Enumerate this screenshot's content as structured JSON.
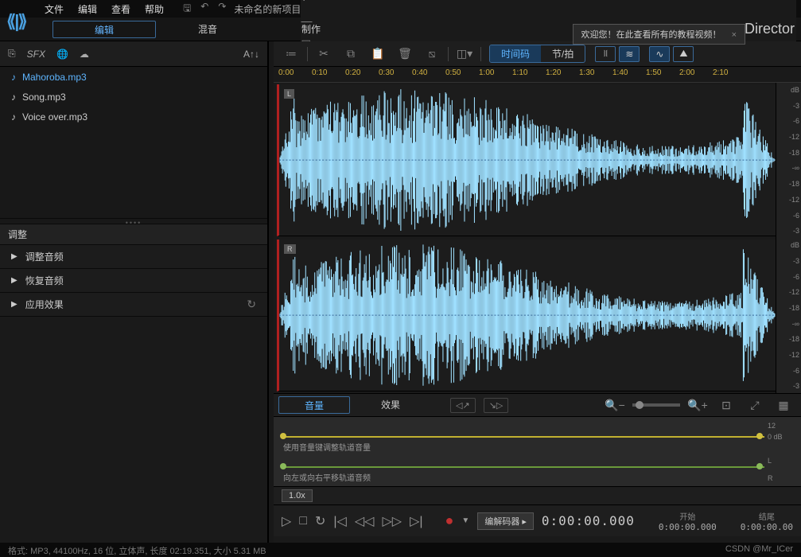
{
  "menu": {
    "file": "文件",
    "edit": "编辑",
    "view": "查看",
    "help": "帮助"
  },
  "project_title": "未命名的新项目",
  "brand": "Director",
  "modes": {
    "edit": "编辑",
    "mix": "混音",
    "produce": "制作"
  },
  "tip": {
    "text": "欢迎您！在此查看所有的教程视频！",
    "close": "×"
  },
  "filebar": {
    "sfx": "SFX",
    "font": "A↑↓"
  },
  "files": [
    {
      "name": "Mahoroba.mp3",
      "selected": true
    },
    {
      "name": "Song.mp3",
      "selected": false
    },
    {
      "name": "Voice over.mp3",
      "selected": false
    }
  ],
  "adjust": {
    "header": "调整",
    "cats": [
      "调整音频",
      "恢复音频",
      "应用效果"
    ]
  },
  "toolbar": {
    "timecode": "时间码",
    "beat": "节/拍"
  },
  "ruler": [
    "0:00",
    "0:10",
    "0:20",
    "0:30",
    "0:40",
    "0:50",
    "1:00",
    "1:10",
    "1:20",
    "1:30",
    "1:40",
    "1:50",
    "2:00",
    "2:10"
  ],
  "channels": {
    "left": "L",
    "right": "R",
    "dbhdr": "dB",
    "levels": [
      "-3",
      "-6",
      "-12",
      "-18",
      "-∞",
      "-18",
      "-12",
      "-6",
      "-3"
    ]
  },
  "fx": {
    "volume": "音量",
    "effect": "效果"
  },
  "env": {
    "vol_label": "使用音量键调整轨道音量",
    "pan_label": "向左或向右平移轨道音频",
    "scale_top": "12",
    "scale_mid": "0",
    "scale_db": "dB",
    "scale_L": "L",
    "scale_R": "R"
  },
  "speed": "1.0x",
  "transport": {
    "codec": "编解码器",
    "time": "0:00:00.000",
    "start_label": "开始",
    "end_label": "结尾",
    "start": "0:00:00.000",
    "end": "0:00:00.00"
  },
  "status": {
    "format": "格式: MP3, 44100Hz, 16 位, 立体声, 长度 02:19.351, 大小 5.31 MB",
    "watermark": "CSDN @Mr_ICer"
  }
}
